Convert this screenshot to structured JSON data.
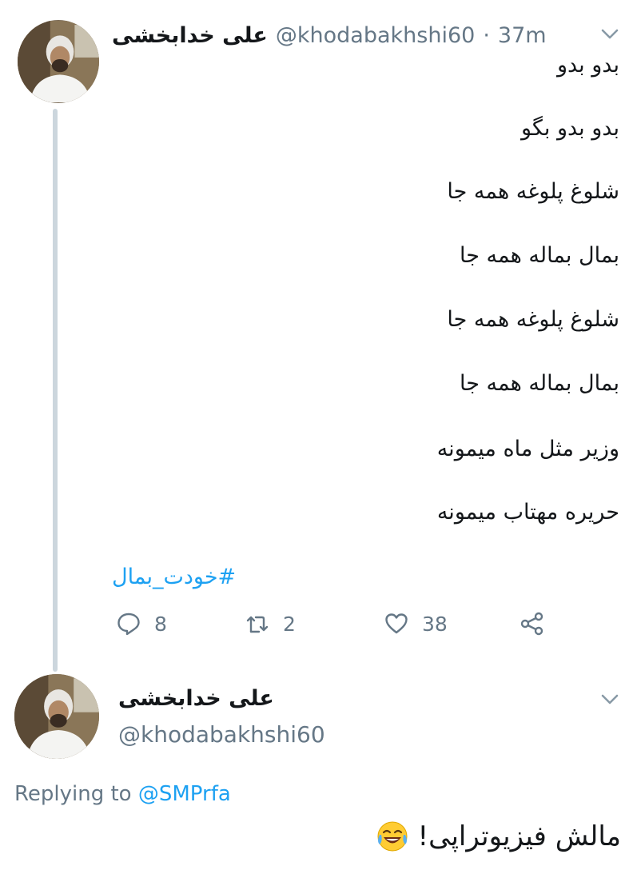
{
  "tweet": {
    "author_name": "علی خدابخشی",
    "handle": "@khodabakhshi60",
    "separator": "·",
    "time": "37m",
    "lines": [
      "بدو بدو",
      "بدو بدو بگو",
      "شلوغ پلوغه همه جا",
      "بمال بماله همه جا",
      "شلوغ پلوغه همه جا",
      "بمال بماله همه جا",
      "وزیر مثل ماه میمونه",
      "حریره مهتاب میمونه"
    ],
    "hashtag": "#خودت_بمال",
    "actions": {
      "reply_icon": "reply-icon",
      "reply_count": "8",
      "retweet_icon": "retweet-icon",
      "retweet_count": "2",
      "like_icon": "heart-icon",
      "like_count": "38",
      "share_icon": "share-icon"
    }
  },
  "reply": {
    "author_name": "علی خدابخشی",
    "handle": "@khodabakhshi60",
    "replying_prefix": "Replying to",
    "replying_to": "@SMPrfa",
    "text": "مالش فیزیوتراپی!",
    "emoji_icon": "tears-of-joy-emoji"
  },
  "colors": {
    "accent": "#1da1f2",
    "secondary_text": "#657786",
    "thread_line": "#ccd6dd"
  }
}
